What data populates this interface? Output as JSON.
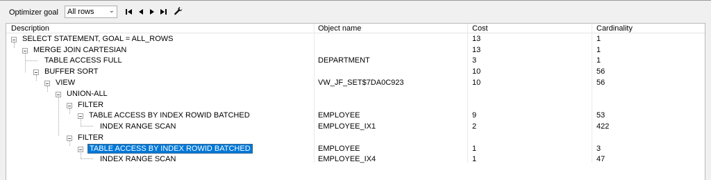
{
  "toolbar": {
    "goal_label": "Optimizer goal",
    "goal_value": "All rows",
    "buttons": [
      "first-icon",
      "prev-icon",
      "next-icon",
      "last-icon",
      "wrench-icon"
    ]
  },
  "columns": {
    "description": "Description",
    "object_name": "Object name",
    "cost": "Cost",
    "cardinality": "Cardinality"
  },
  "rows": [
    {
      "desc": "SELECT STATEMENT, GOAL = ALL_ROWS",
      "object": "",
      "cost": "13",
      "card": "1"
    },
    {
      "desc": "MERGE JOIN CARTESIAN",
      "object": "",
      "cost": "13",
      "card": "1"
    },
    {
      "desc": "TABLE ACCESS FULL",
      "object": "DEPARTMENT",
      "cost": "3",
      "card": "1"
    },
    {
      "desc": "BUFFER SORT",
      "object": "",
      "cost": "10",
      "card": "56"
    },
    {
      "desc": "VIEW",
      "object": "VW_JF_SET$7DA0C923",
      "cost": "10",
      "card": "56"
    },
    {
      "desc": "UNION-ALL",
      "object": "",
      "cost": "",
      "card": ""
    },
    {
      "desc": "FILTER",
      "object": "",
      "cost": "",
      "card": ""
    },
    {
      "desc": "TABLE ACCESS BY INDEX ROWID BATCHED",
      "object": "EMPLOYEE",
      "cost": "9",
      "card": "53"
    },
    {
      "desc": "INDEX RANGE SCAN",
      "object": "EMPLOYEE_IX1",
      "cost": "2",
      "card": "422"
    },
    {
      "desc": "FILTER",
      "object": "",
      "cost": "",
      "card": ""
    },
    {
      "desc": "TABLE ACCESS BY INDEX ROWID BATCHED",
      "object": "EMPLOYEE",
      "cost": "1",
      "card": "3"
    },
    {
      "desc": "INDEX RANGE SCAN",
      "object": "EMPLOYEE_IX4",
      "cost": "1",
      "card": "47"
    }
  ],
  "colors": {
    "selection": "#0078d7"
  }
}
